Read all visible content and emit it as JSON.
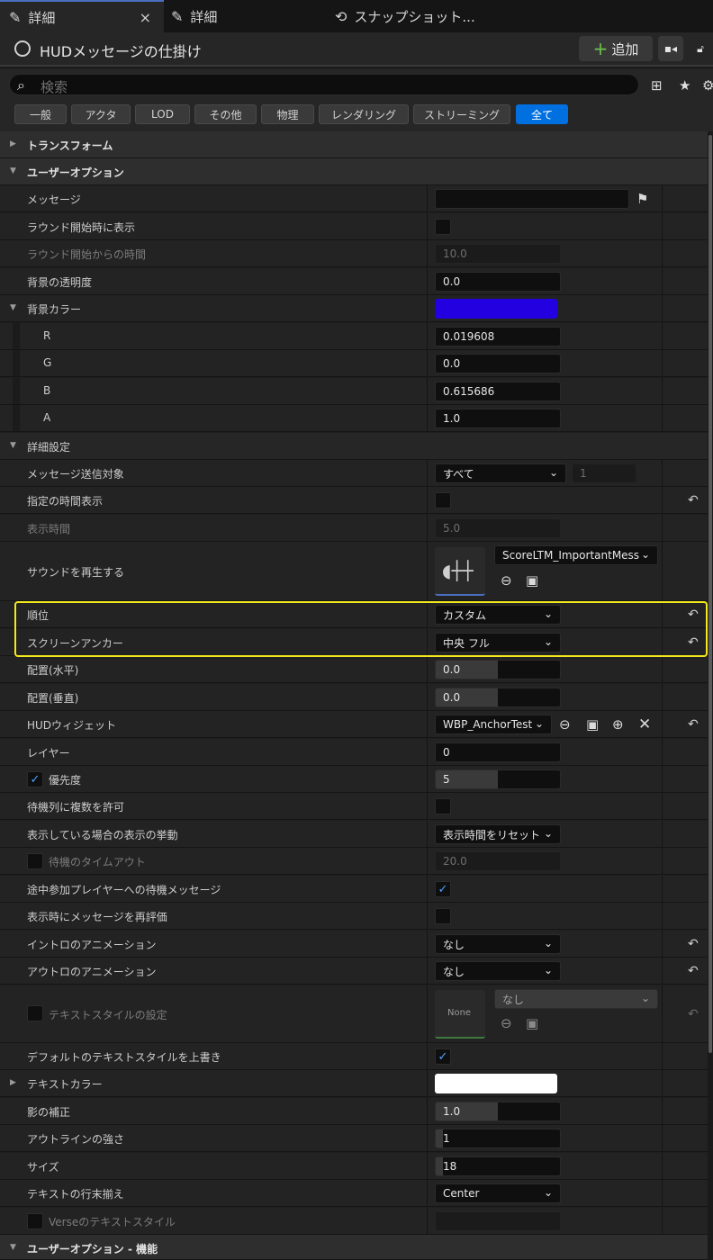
{
  "tabs": [
    {
      "label": "詳細",
      "close": "×"
    },
    {
      "label": "詳細"
    },
    {
      "label": "スナップショット..."
    }
  ],
  "actor": {
    "name": "HUDメッセージの仕掛け",
    "add_label": "追加"
  },
  "search": {
    "placeholder": "検索"
  },
  "filters": [
    "一般",
    "アクタ",
    "LOD",
    "その他",
    "物理",
    "レンダリング",
    "ストリーミング",
    "全て"
  ],
  "colors": {
    "accent": "#0070e0",
    "highlight": "#f2e81c",
    "bg_color": "#2200e0",
    "text_color": "#ffffff"
  },
  "sections": {
    "transform": "トランスフォーム",
    "user_options": "ユーザーオプション",
    "bg_color": "背景カラー",
    "advanced": "詳細設定",
    "text_color": "テキストカラー",
    "user_options_func": "ユーザーオプション - 機能"
  },
  "props": {
    "message": "メッセージ",
    "show_round_start": "ラウンド開始時に表示",
    "time_from_round_start": {
      "label": "ラウンド開始からの時間",
      "value": "10.0"
    },
    "bg_opacity": {
      "label": "背景の透明度",
      "value": "0.0"
    },
    "r": {
      "label": "R",
      "value": "0.019608"
    },
    "g": {
      "label": "G",
      "value": "0.0"
    },
    "b": {
      "label": "B",
      "value": "0.615686"
    },
    "a": {
      "label": "A",
      "value": "1.0"
    },
    "send_target": {
      "label": "メッセージ送信対象",
      "value": "すべて",
      "num": "1"
    },
    "timed_display": "指定の時間表示",
    "display_time": {
      "label": "表示時間",
      "value": "5.0"
    },
    "play_sound": {
      "label": "サウンドを再生する",
      "value": "ScoreLTM_ImportantMess"
    },
    "order": {
      "label": "順位",
      "value": "カスタム"
    },
    "screen_anchor": {
      "label": "スクリーンアンカー",
      "value": "中央 フル"
    },
    "align_h": {
      "label": "配置(水平)",
      "value": "0.0",
      "fill": 0.5
    },
    "align_v": {
      "label": "配置(垂直)",
      "value": "0.0",
      "fill": 0.5
    },
    "hud_widget": {
      "label": "HUDウィジェット",
      "value": "WBP_AnchorTest"
    },
    "layer": {
      "label": "レイヤー",
      "value": "0"
    },
    "priority": {
      "label": "優先度",
      "value": "5",
      "fill": 0.5
    },
    "allow_queue": "待機列に複数を許可",
    "behavior": {
      "label": "表示している場合の表示の挙動",
      "value": "表示時間をリセット"
    },
    "queue_timeout": {
      "label": "待機のタイムアウト",
      "value": "20.0"
    },
    "jip_message": "途中参加プレイヤーへの待機メッセージ",
    "reeval": "表示時にメッセージを再評価",
    "intro_anim": {
      "label": "イントロのアニメーション",
      "value": "なし"
    },
    "outro_anim": {
      "label": "アウトロのアニメーション",
      "value": "なし"
    },
    "text_style": {
      "label": "テキストスタイルの設定",
      "value": "なし",
      "thumb": "None"
    },
    "override_style": "デフォルトのテキストスタイルを上書き",
    "shadow": {
      "label": "影の補正",
      "value": "1.0",
      "fill": 0.5
    },
    "outline": {
      "label": "アウトラインの強さ",
      "value": "1",
      "fill": 0.06
    },
    "size": {
      "label": "サイズ",
      "value": "18",
      "fill": 0.06
    },
    "justify": {
      "label": "テキストの行末揃え",
      "value": "Center"
    },
    "verse_style": "Verseのテキストスタイル"
  }
}
